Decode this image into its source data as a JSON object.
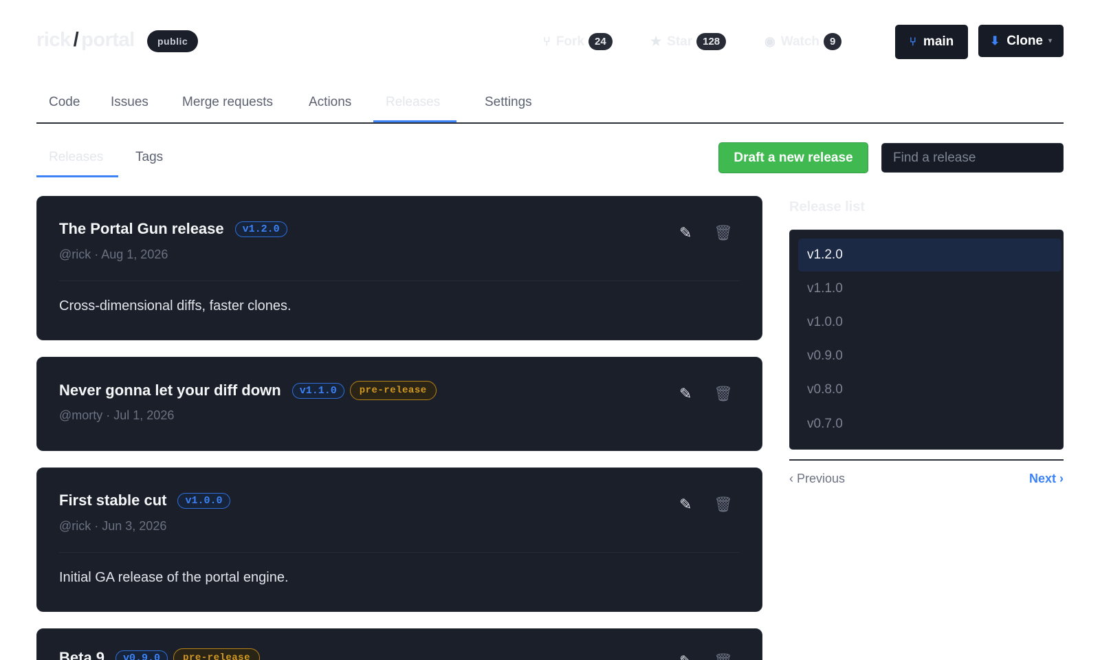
{
  "repo": {
    "owner": "rick",
    "separator": "/",
    "name": "portal",
    "visibility": "public"
  },
  "stats": {
    "fork": {
      "label": "Fork",
      "icon": "fork-icon",
      "count": "24"
    },
    "star": {
      "label": "Star",
      "icon": "star-icon",
      "count": "128"
    },
    "watch": {
      "label": "Watch",
      "icon": "eye-icon",
      "count": "9"
    }
  },
  "branch_button": {
    "label": "main",
    "icon": "branch-icon"
  },
  "clone_button": {
    "label": "Clone",
    "icon": "download-icon"
  },
  "main_tabs": [
    {
      "label": "Code"
    },
    {
      "label": "Issues"
    },
    {
      "label": "Merge requests"
    },
    {
      "label": "Actions"
    },
    {
      "label": "Releases",
      "active": true
    },
    {
      "label": "Settings"
    }
  ],
  "sub_tabs": [
    {
      "label": "Releases",
      "active": true
    },
    {
      "label": "Tags"
    }
  ],
  "draft_button": "Draft a new release",
  "search": {
    "placeholder": "Find a release",
    "value": ""
  },
  "releases": [
    {
      "title": "The Portal Gun release",
      "tag": "v1.2.0",
      "prerelease": "",
      "meta": "@rick · Aug 1, 2026",
      "body": "Cross-dimensional diffs, faster clones."
    },
    {
      "title": "Never gonna let your diff down",
      "tag": "v1.1.0",
      "prerelease": "pre-release",
      "meta": "@morty · Jul 1, 2026",
      "body": ""
    },
    {
      "title": "First stable cut",
      "tag": "v1.0.0",
      "prerelease": "",
      "meta": "@rick · Jun 3, 2026",
      "body": "Initial GA release of the portal engine."
    },
    {
      "title": "Beta 9",
      "tag": "v0.9.0",
      "prerelease": "pre-release",
      "meta": "",
      "body": ""
    }
  ],
  "sidebar": {
    "title": "Release list",
    "items": [
      "v1.2.0",
      "v1.1.0",
      "v1.0.0",
      "v0.9.0",
      "v0.8.0",
      "v0.7.0"
    ],
    "selected": "v1.2.0"
  },
  "pager": {
    "prev": "‹ Previous",
    "next": "Next ›"
  },
  "colors": {
    "accent": "#3b82f6",
    "success": "#3fb950",
    "warning": "#d29922",
    "card_bg": "#1a1f2a"
  }
}
